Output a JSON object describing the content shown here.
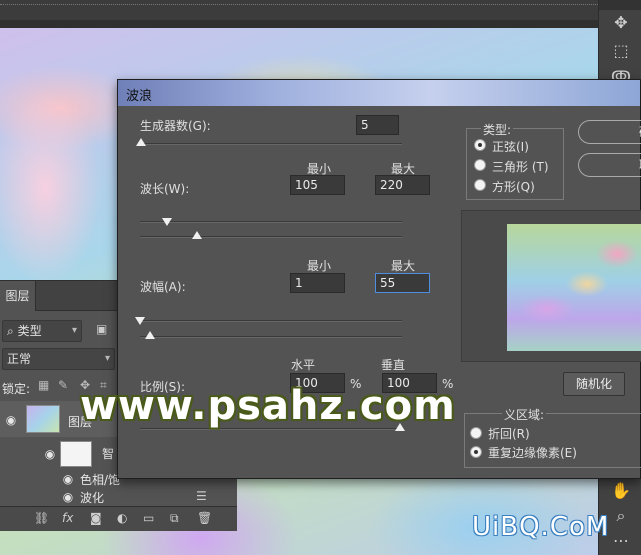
{
  "dialog": {
    "title": "波浪",
    "generators": {
      "label": "生成器数(G):",
      "value": "5"
    },
    "wavelength": {
      "label": "波长(W):",
      "min_header": "最小",
      "max_header": "最大",
      "min": "105",
      "max": "220"
    },
    "amplitude": {
      "label": "波幅(A):",
      "min_header": "最小",
      "max_header": "最大",
      "min": "1",
      "max": "55"
    },
    "scale": {
      "label": "比例(S):",
      "h_header": "水平",
      "v_header": "垂直",
      "h": "100",
      "v": "100",
      "unit": "%"
    },
    "type": {
      "title": "类型:",
      "options": [
        {
          "label": "正弦(I)",
          "selected": true
        },
        {
          "label": "三角形 (T)",
          "selected": false
        },
        {
          "label": "方形(Q)",
          "selected": false
        }
      ]
    },
    "ok_label": "确",
    "cancel_label": "取",
    "randomize_label": "随机化",
    "undefined_area": {
      "title": "义区域:",
      "options": [
        {
          "label": "折回(R)",
          "selected": false
        },
        {
          "label": "重复边缘像素(E)",
          "selected": true
        }
      ]
    }
  },
  "layers_panel": {
    "tab_label": "图层",
    "filter_label": "类型",
    "blend_mode": "正常",
    "lock_label": "锁定:",
    "layers": [
      {
        "name": "图层"
      },
      {
        "name": "智"
      },
      {
        "name": "色相/饱"
      },
      {
        "name": "波化"
      }
    ]
  },
  "watermark": "www.psahz.com",
  "watermark2": "UiBQ.CoM"
}
